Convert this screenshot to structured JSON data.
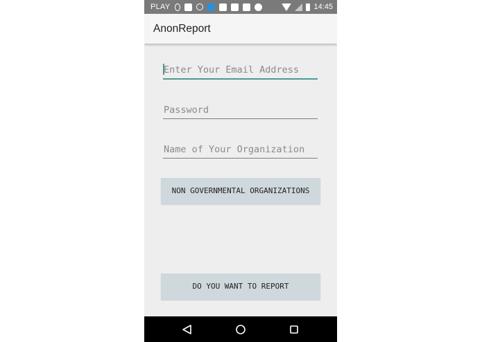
{
  "status_bar": {
    "carrier": "PLAY",
    "time": "14:45",
    "notification_icons": [
      "location-pin-icon",
      "square-icon",
      "chrome-icon",
      "weather-icon",
      "youtube-icon",
      "gallery-icon",
      "download-icon",
      "android-icon"
    ]
  },
  "app": {
    "title": "AnonReport"
  },
  "form": {
    "email_placeholder": "Enter Your Email Address",
    "email_value": "",
    "password_placeholder": "Password",
    "password_value": "",
    "organization_placeholder": "Name of Your Organization",
    "organization_value": ""
  },
  "buttons": {
    "ngo_label": "NON GOVERNMENTAL ORGANIZATIONS",
    "report_label": "DO YOU WANT TO REPORT"
  },
  "nav": {
    "icons": [
      "back-icon",
      "home-icon",
      "recents-icon"
    ]
  },
  "colors": {
    "accent": "#4d9a8f",
    "button_bg": "#cfd8dc",
    "status_bar": "#7a7a7a",
    "background": "#eeeeee"
  }
}
